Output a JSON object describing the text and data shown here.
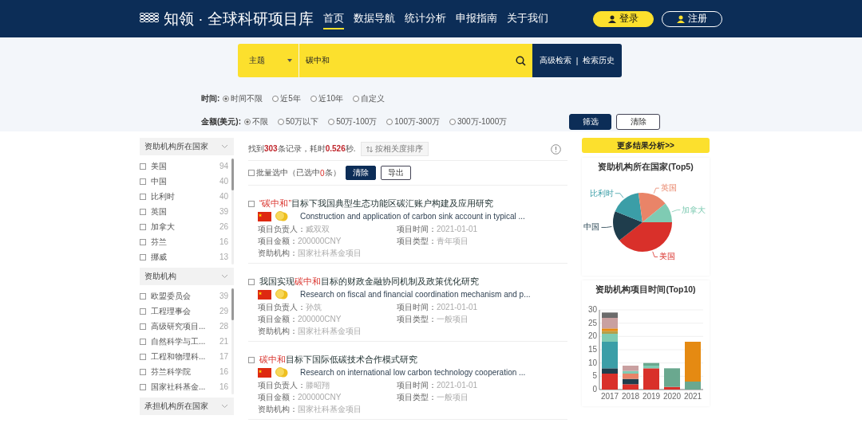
{
  "header": {
    "title": "知领 · 全球科研项目库",
    "nav": [
      {
        "label": "首页",
        "selected": true
      },
      {
        "label": "数据导航",
        "selected": false
      },
      {
        "label": "统计分析",
        "selected": false
      },
      {
        "label": "申报指南",
        "selected": false
      },
      {
        "label": "关于我们",
        "selected": false
      }
    ],
    "login": "登录",
    "register": "注册"
  },
  "search": {
    "field_select": "主题",
    "query": "碳中和",
    "advanced": "高级检索",
    "separator": "|",
    "history": "检索历史"
  },
  "filters": [
    {
      "label": "时间:",
      "options": [
        {
          "label": "时间不限",
          "selected": true
        },
        {
          "label": "近5年",
          "selected": false
        },
        {
          "label": "近10年",
          "selected": false
        },
        {
          "label": "自定义",
          "selected": false
        }
      ]
    },
    {
      "label": "金额(美元):",
      "options": [
        {
          "label": "不限",
          "selected": true
        },
        {
          "label": "50万以下",
          "selected": false
        },
        {
          "label": "50万-100万",
          "selected": false
        },
        {
          "label": "100万-300万",
          "selected": false
        },
        {
          "label": "300万-1000万",
          "selected": false
        }
      ]
    }
  ],
  "filter_buttons": {
    "apply": "筛选",
    "clear": "清除"
  },
  "sidebar": [
    {
      "title": "资助机构所在国家",
      "items": [
        {
          "label": "美国",
          "count": "94",
          "checked": false
        },
        {
          "label": "中国",
          "count": "40",
          "checked": false
        },
        {
          "label": "比利时",
          "count": "40",
          "checked": false
        },
        {
          "label": "英国",
          "count": "39",
          "checked": false
        },
        {
          "label": "加拿大",
          "count": "26",
          "checked": false
        },
        {
          "label": "芬兰",
          "count": "16",
          "checked": false
        },
        {
          "label": "挪威",
          "count": "13",
          "checked": false
        }
      ]
    },
    {
      "title": "资助机构",
      "items": [
        {
          "label": "欧盟委员会",
          "count": "39",
          "checked": false
        },
        {
          "label": "工程理事会",
          "count": "29",
          "checked": false
        },
        {
          "label": "高级研究项目...",
          "count": "28",
          "checked": false
        },
        {
          "label": "自然科学与工...",
          "count": "21",
          "checked": false
        },
        {
          "label": "工程和物理科...",
          "count": "17",
          "checked": false
        },
        {
          "label": "芬兰科学院",
          "count": "16",
          "checked": false
        },
        {
          "label": "国家社科基金...",
          "count": "16",
          "checked": false
        }
      ]
    },
    {
      "title": "承担机构所在国家"
    }
  ],
  "results": {
    "summary": {
      "prefix": "找到",
      "count": "303",
      "middle": "条记录，耗时",
      "time": "0.526",
      "suffix": "秒."
    },
    "sort": "按相关度排序",
    "bulk": {
      "prefix": "批量选中（已选中",
      "count": "0",
      "suffix": "条）",
      "checked": false
    },
    "clear": "清除",
    "export": "导出",
    "items": [
      {
        "checked": false,
        "title": [
          {
            "text": "“碳中和”",
            "highlight": true
          },
          {
            "text": "目标下我国典型生态功能区碳汇账户构建及应用研究",
            "highlight": false
          }
        ],
        "english": "Construction and application of carbon sink account in typical ...",
        "meta": [
          {
            "label": "项目负责人：",
            "value": "臧双双"
          },
          {
            "label": "项目时间：",
            "value": "2021-01-01"
          },
          {
            "label": "项目金额：",
            "value": "200000CNY"
          },
          {
            "label": "项目类型：",
            "value": "青年项目"
          },
          {
            "label": "资助机构：",
            "value": "国家社科基金项目"
          }
        ]
      },
      {
        "checked": false,
        "title": [
          {
            "text": "我国实现",
            "highlight": false
          },
          {
            "text": "碳中和",
            "highlight": true
          },
          {
            "text": "目标的财政金融协同机制及政策优化研究",
            "highlight": false
          }
        ],
        "english": "Research on fiscal and financial coordination mechanism and p...",
        "meta": [
          {
            "label": "项目负责人：",
            "value": "孙筑"
          },
          {
            "label": "项目时间：",
            "value": "2021-01-01"
          },
          {
            "label": "项目金额：",
            "value": "200000CNY"
          },
          {
            "label": "项目类型：",
            "value": "一般项目"
          },
          {
            "label": "资助机构：",
            "value": "国家社科基金项目"
          }
        ]
      },
      {
        "checked": false,
        "title": [
          {
            "text": "碳中和",
            "highlight": true
          },
          {
            "text": "目标下国际低碳技术合作模式研究",
            "highlight": false
          }
        ],
        "english": "Research on international low carbon technology cooperation ...",
        "meta": [
          {
            "label": "项目负责人：",
            "value": "滕昭翔"
          },
          {
            "label": "项目时间：",
            "value": "2021-01-01"
          },
          {
            "label": "项目金额：",
            "value": "200000CNY"
          },
          {
            "label": "项目类型：",
            "value": "一般项目"
          },
          {
            "label": "资助机构：",
            "value": "国家社科基金项目"
          }
        ]
      }
    ]
  },
  "analysis": {
    "more": "更多结果分析>>",
    "pie": {
      "chart_data": {
        "type": "pie",
        "title": "资助机构所在国家(Top5)",
        "categories": [
          "美国",
          "中国",
          "比利时",
          "英国",
          "加拿大"
        ],
        "values": [
          39.4,
          16.7,
          16.7,
          16.3,
          10.9
        ],
        "colors": [
          "#d9302a",
          "#1f3d4c",
          "#3b9ea7",
          "#e98468",
          "#7fcbb3"
        ]
      }
    },
    "bar": {
      "chart_data": {
        "type": "bar",
        "title": "资助机构项目时间(Top10)",
        "stacked": true,
        "grid": true,
        "categories": [
          "2017",
          "2018",
          "2019",
          "2020",
          "2021"
        ],
        "ylim": [
          0,
          30
        ],
        "yticks": [
          0,
          5,
          10,
          15,
          20,
          25,
          30
        ],
        "series": [
          {
            "color": "#d9302a",
            "values": [
              6,
              2,
              8,
              1,
              0
            ]
          },
          {
            "color": "#1f3d4c",
            "values": [
              2,
              2,
              0,
              0,
              0
            ]
          },
          {
            "color": "#3b9ea7",
            "values": [
              10,
              0,
              0,
              0,
              0
            ]
          },
          {
            "color": "#e98468",
            "values": [
              0,
              2,
              0,
              0,
              0
            ]
          },
          {
            "color": "#7fcbb3",
            "values": [
              3,
              1,
              1,
              0,
              0
            ]
          },
          {
            "color": "#6aa88f",
            "values": [
              0,
              0,
              1,
              7,
              3
            ]
          },
          {
            "color": "#b5a04a",
            "values": [
              1,
              0,
              0,
              0,
              0
            ]
          },
          {
            "color": "#e58a12",
            "values": [
              1,
              0,
              0,
              0,
              15
            ]
          },
          {
            "color": "#c9a0a0",
            "values": [
              4,
              2,
              0,
              0,
              0
            ]
          },
          {
            "color": "#6b6b6b",
            "values": [
              2,
              0,
              0,
              0,
              0
            ]
          }
        ]
      }
    }
  }
}
